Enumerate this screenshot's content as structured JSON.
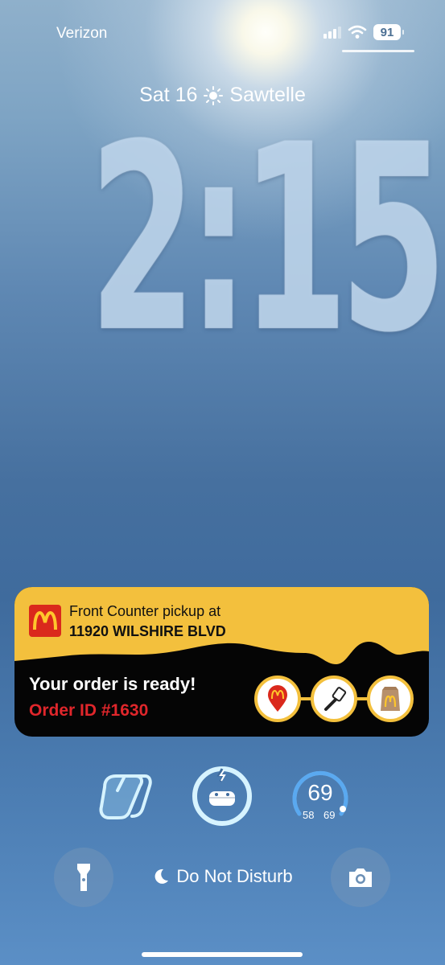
{
  "status_bar": {
    "carrier": "Verizon",
    "battery": "91",
    "icons": [
      "signal-icon",
      "wifi-icon",
      "battery-icon"
    ]
  },
  "lock_screen": {
    "date": "Sat 16",
    "weather_icon": "sun-icon",
    "location": "Sawtelle",
    "time": "2:15"
  },
  "live_activity": {
    "app": "McDonald's",
    "logo_icon": "mcdonalds-logo-icon",
    "pickup_line1": "Front Counter pickup at",
    "pickup_line2": "11920 WILSHIRE BLVD",
    "status": "Your order is ready!",
    "order_id": "Order ID #1630",
    "steps": [
      "location-pin-step-icon",
      "spatula-step-icon",
      "bag-step-icon"
    ],
    "colors": {
      "header": "#f3c03d",
      "body": "#050505",
      "order_id": "#e0262b",
      "logo": "#da291c"
    }
  },
  "widgets": {
    "copilot_icon": "copilot-icon",
    "airpods_icon": "airpods-charging-icon",
    "temperature": {
      "current": "69",
      "low": "58",
      "high": "69"
    }
  },
  "bottom": {
    "focus_label": "Do Not Disturb",
    "focus_icon": "moon-icon",
    "left_icon": "flashlight-icon",
    "right_icon": "camera-icon"
  }
}
